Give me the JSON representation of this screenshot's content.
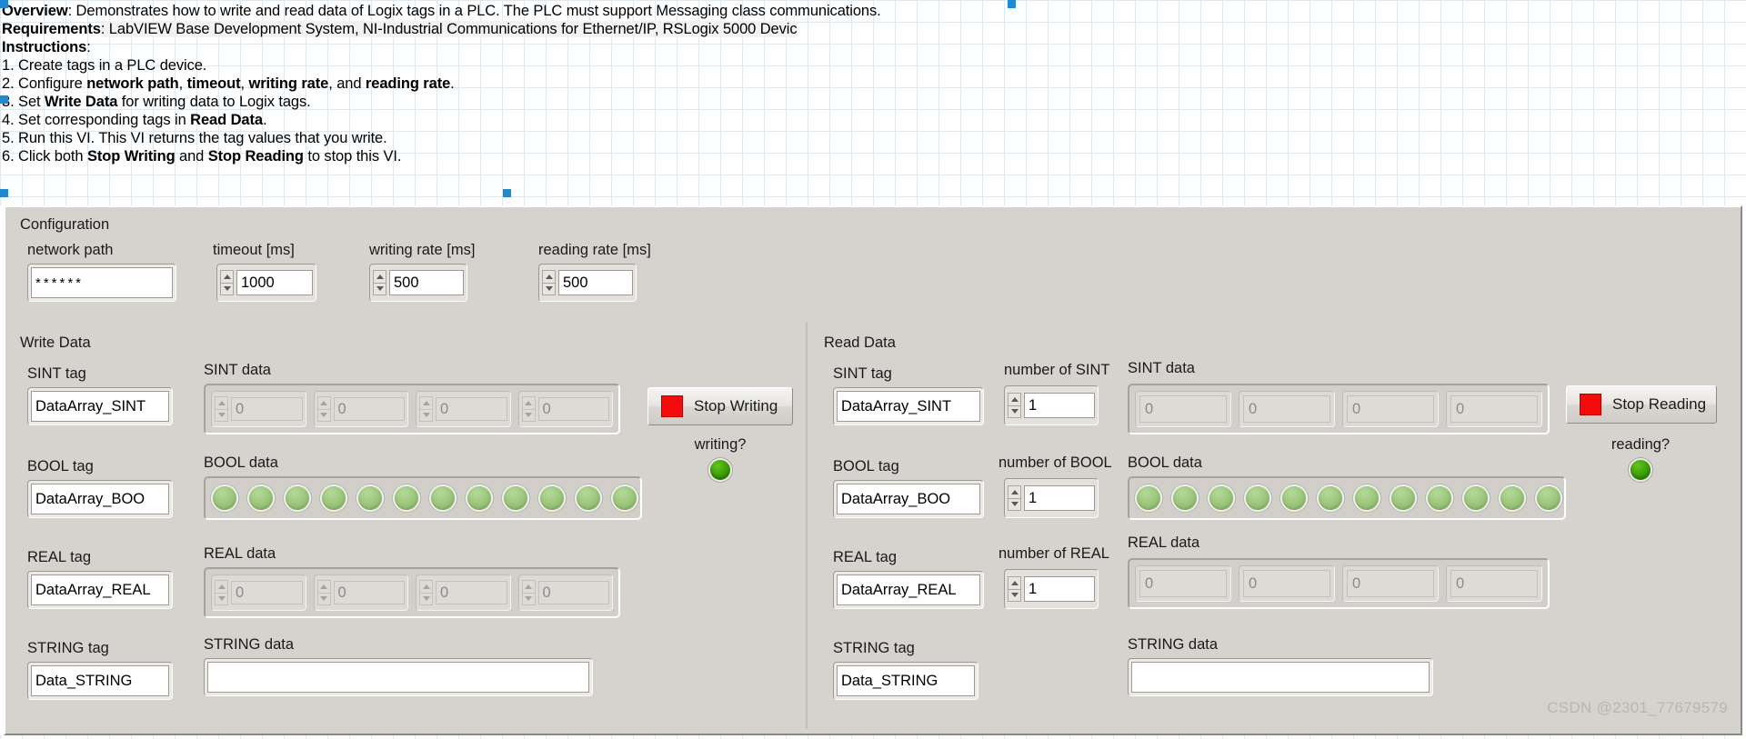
{
  "doc": {
    "lines": [
      {
        "prefix": "Overview",
        "bold_prefix": true,
        "text": ": Demonstrates how to write and read data of Logix tags in a PLC. The PLC must support Messaging class communications."
      },
      {
        "prefix": "Requirements",
        "bold_prefix": true,
        "text": ": LabVIEW Base Development System, NI-Industrial Communications for Ethernet/IP, RSLogix 5000 Devic"
      },
      {
        "prefix": "Instructions",
        "bold_prefix": true,
        "text": ":"
      },
      {
        "prefix": "",
        "bold_prefix": false,
        "text": "1. Create tags in a PLC device."
      },
      {
        "prefix": "",
        "bold_prefix": false,
        "text": "2. Configure network path, timeout, writing rate, and reading rate."
      },
      {
        "prefix": "",
        "bold_prefix": false,
        "text": "3. Set Write Data for writing data to Logix tags."
      },
      {
        "prefix": "",
        "bold_prefix": false,
        "text": "4. Set corresponding tags in Read Data."
      },
      {
        "prefix": "",
        "bold_prefix": false,
        "text": "5. Run this VI. This VI returns the tag values that you write."
      },
      {
        "prefix": "",
        "bold_prefix": false,
        "text": "6. Click both Stop Writing and Stop Reading to stop this VI."
      }
    ]
  },
  "configuration": {
    "title": "Configuration",
    "network_path": {
      "label": "network path",
      "value": "******"
    },
    "timeout": {
      "label": "timeout [ms]",
      "value": "1000"
    },
    "writing_rate": {
      "label": "writing rate [ms]",
      "value": "500"
    },
    "reading_rate": {
      "label": "reading rate [ms]",
      "value": "500"
    }
  },
  "write_data": {
    "title": "Write Data",
    "sint_tag": {
      "label": "SINT tag",
      "value": "DataArray_SINT"
    },
    "bool_tag": {
      "label": "BOOL tag",
      "value": "DataArray_BOO"
    },
    "real_tag": {
      "label": "REAL tag",
      "value": "DataArray_REAL"
    },
    "string_tag": {
      "label": "STRING tag",
      "value": "Data_STRING"
    },
    "sint_data": {
      "label": "SINT data",
      "values": [
        "0",
        "0",
        "0",
        "0"
      ]
    },
    "bool_data": {
      "label": "BOOL data",
      "states": [
        false,
        false,
        false,
        false,
        false,
        false,
        false,
        false,
        false,
        false,
        false,
        false
      ]
    },
    "real_data": {
      "label": "REAL data",
      "values": [
        "0",
        "0",
        "0",
        "0"
      ]
    },
    "string_data": {
      "label": "STRING data",
      "value": ""
    },
    "stop_button": {
      "label": "Stop Writing"
    },
    "status_led": {
      "label": "writing?",
      "on": true
    }
  },
  "read_data": {
    "title": "Read Data",
    "sint_tag": {
      "label": "SINT tag",
      "value": "DataArray_SINT"
    },
    "bool_tag": {
      "label": "BOOL tag",
      "value": "DataArray_BOO"
    },
    "real_tag": {
      "label": "REAL tag",
      "value": "DataArray_REAL"
    },
    "string_tag": {
      "label": "STRING tag",
      "value": "Data_STRING"
    },
    "number_of_sint": {
      "label": "number of SINT",
      "value": "1"
    },
    "number_of_bool": {
      "label": "number of BOOL",
      "value": "1"
    },
    "number_of_real": {
      "label": "number of REAL",
      "value": "1"
    },
    "sint_data": {
      "label": "SINT data",
      "values": [
        "0",
        "0",
        "0",
        "0"
      ]
    },
    "bool_data": {
      "label": "BOOL data",
      "states": [
        false,
        false,
        false,
        false,
        false,
        false,
        false,
        false,
        false,
        false,
        false,
        false
      ]
    },
    "real_data": {
      "label": "REAL data",
      "values": [
        "0",
        "0",
        "0",
        "0"
      ]
    },
    "string_data": {
      "label": "STRING data",
      "value": ""
    },
    "stop_button": {
      "label": "Stop Reading"
    },
    "status_led": {
      "label": "reading?",
      "on": true
    }
  },
  "watermark": {
    "text": "CSDN @2301_77679579"
  },
  "colors": {
    "panel_bg": "#d6d3ce",
    "stop_red": "#f40b0b",
    "led_on_green": "#3fa309",
    "led_off_green": "#9ec97f",
    "selection_blue": "#1f8ad2"
  }
}
